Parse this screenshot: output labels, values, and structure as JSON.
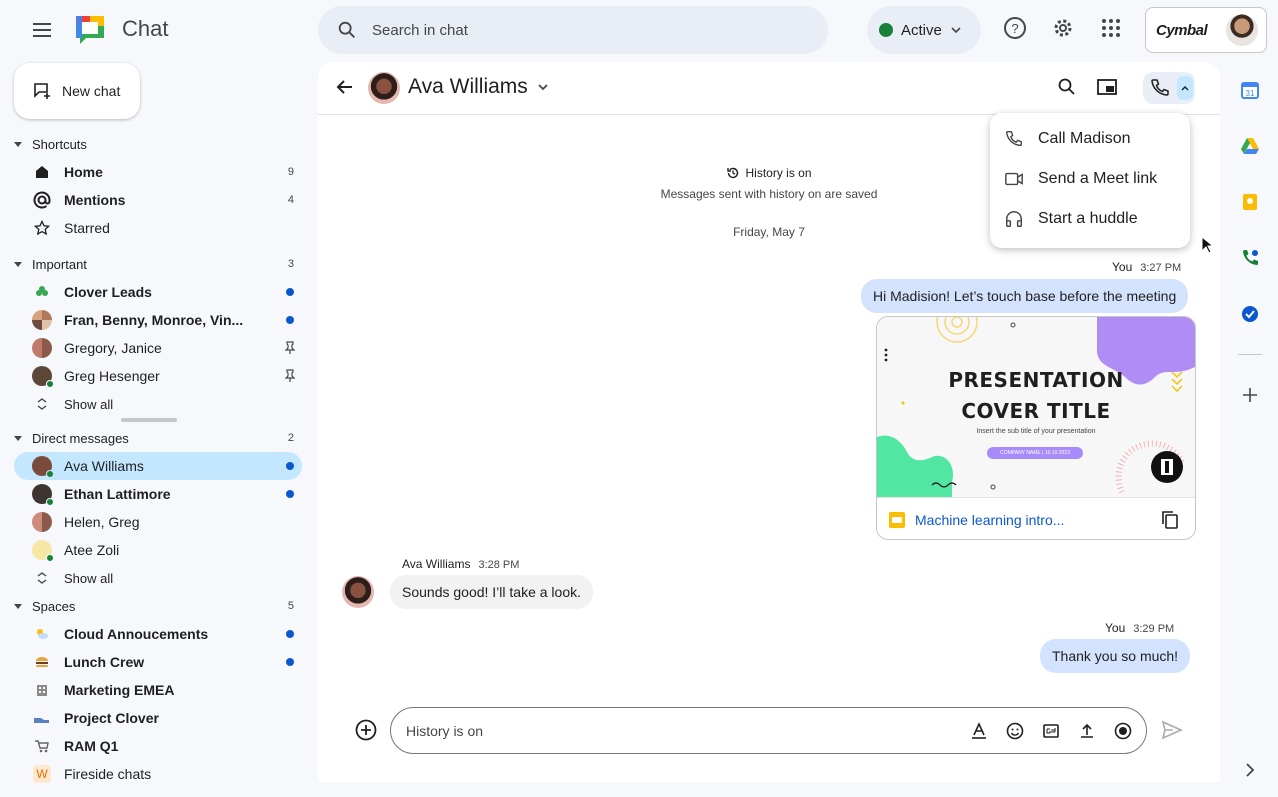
{
  "app": {
    "title": "Chat"
  },
  "search": {
    "placeholder": "Search in chat"
  },
  "status": {
    "label": "Active",
    "color": "#188038"
  },
  "account": {
    "brand": "Cymbal"
  },
  "sidebar": {
    "new_chat_label": "New chat",
    "shortcuts": {
      "title": "Shortcuts",
      "items": [
        {
          "label": "Home",
          "count": "9",
          "icon": "home-icon"
        },
        {
          "label": "Mentions",
          "count": "4",
          "icon": "at-icon"
        },
        {
          "label": "Starred",
          "icon": "star-icon"
        }
      ]
    },
    "important": {
      "title": "Important",
      "count": "3",
      "items": [
        {
          "label": "Clover Leads"
        },
        {
          "label": "Fran, Benny, Monroe, Vin..."
        },
        {
          "label": "Gregory, Janice"
        },
        {
          "label": "Greg Hesenger"
        }
      ],
      "show_all": "Show all"
    },
    "direct_messages": {
      "title": "Direct messages",
      "count": "2",
      "items": [
        {
          "label": "Ava Williams"
        },
        {
          "label": "Ethan Lattimore"
        },
        {
          "label": "Helen, Greg"
        },
        {
          "label": "Atee Zoli"
        }
      ],
      "show_all": "Show all"
    },
    "spaces": {
      "title": "Spaces",
      "count": "5",
      "items": [
        {
          "label": "Cloud Annoucements"
        },
        {
          "label": "Lunch Crew"
        },
        {
          "label": "Marketing EMEA"
        },
        {
          "label": "Project Clover"
        },
        {
          "label": "RAM Q1"
        },
        {
          "label": "Fireside chats",
          "badge": "W"
        }
      ]
    }
  },
  "chat": {
    "name": "Ava Williams",
    "history_title": "History is on",
    "history_sub": "Messages sent with history on are saved",
    "date": "Friday, May 7",
    "messages": [
      {
        "sender": "You",
        "time": "3:27 PM",
        "text": "Hi Madision! Let’s touch base before the meeting"
      },
      {
        "sender": "Ava Williams",
        "time": "3:28 PM",
        "text": "Sounds good! I’ll take a look."
      },
      {
        "sender": "You",
        "time": "3:29 PM",
        "text": "Thank you so much!"
      }
    ],
    "attachment": {
      "slide_title_1": "PRESENTATION",
      "slide_title_2": "COVER TITLE",
      "slide_sub": "Insert the sub title of your presentation",
      "slide_pill": "COMPANY NAME | 10.10.2023",
      "link": "Machine learning intro..."
    },
    "composer_placeholder": "History is on"
  },
  "call_menu": {
    "items": [
      {
        "label": "Call Madison",
        "icon": "phone-icon"
      },
      {
        "label": "Send a Meet link",
        "icon": "video-icon"
      },
      {
        "label": "Start a huddle",
        "icon": "headphones-icon"
      }
    ]
  },
  "colors": {
    "accent": "#0b57d0",
    "selected": "#c2e7ff",
    "bubble_out": "#d3e3fd"
  }
}
